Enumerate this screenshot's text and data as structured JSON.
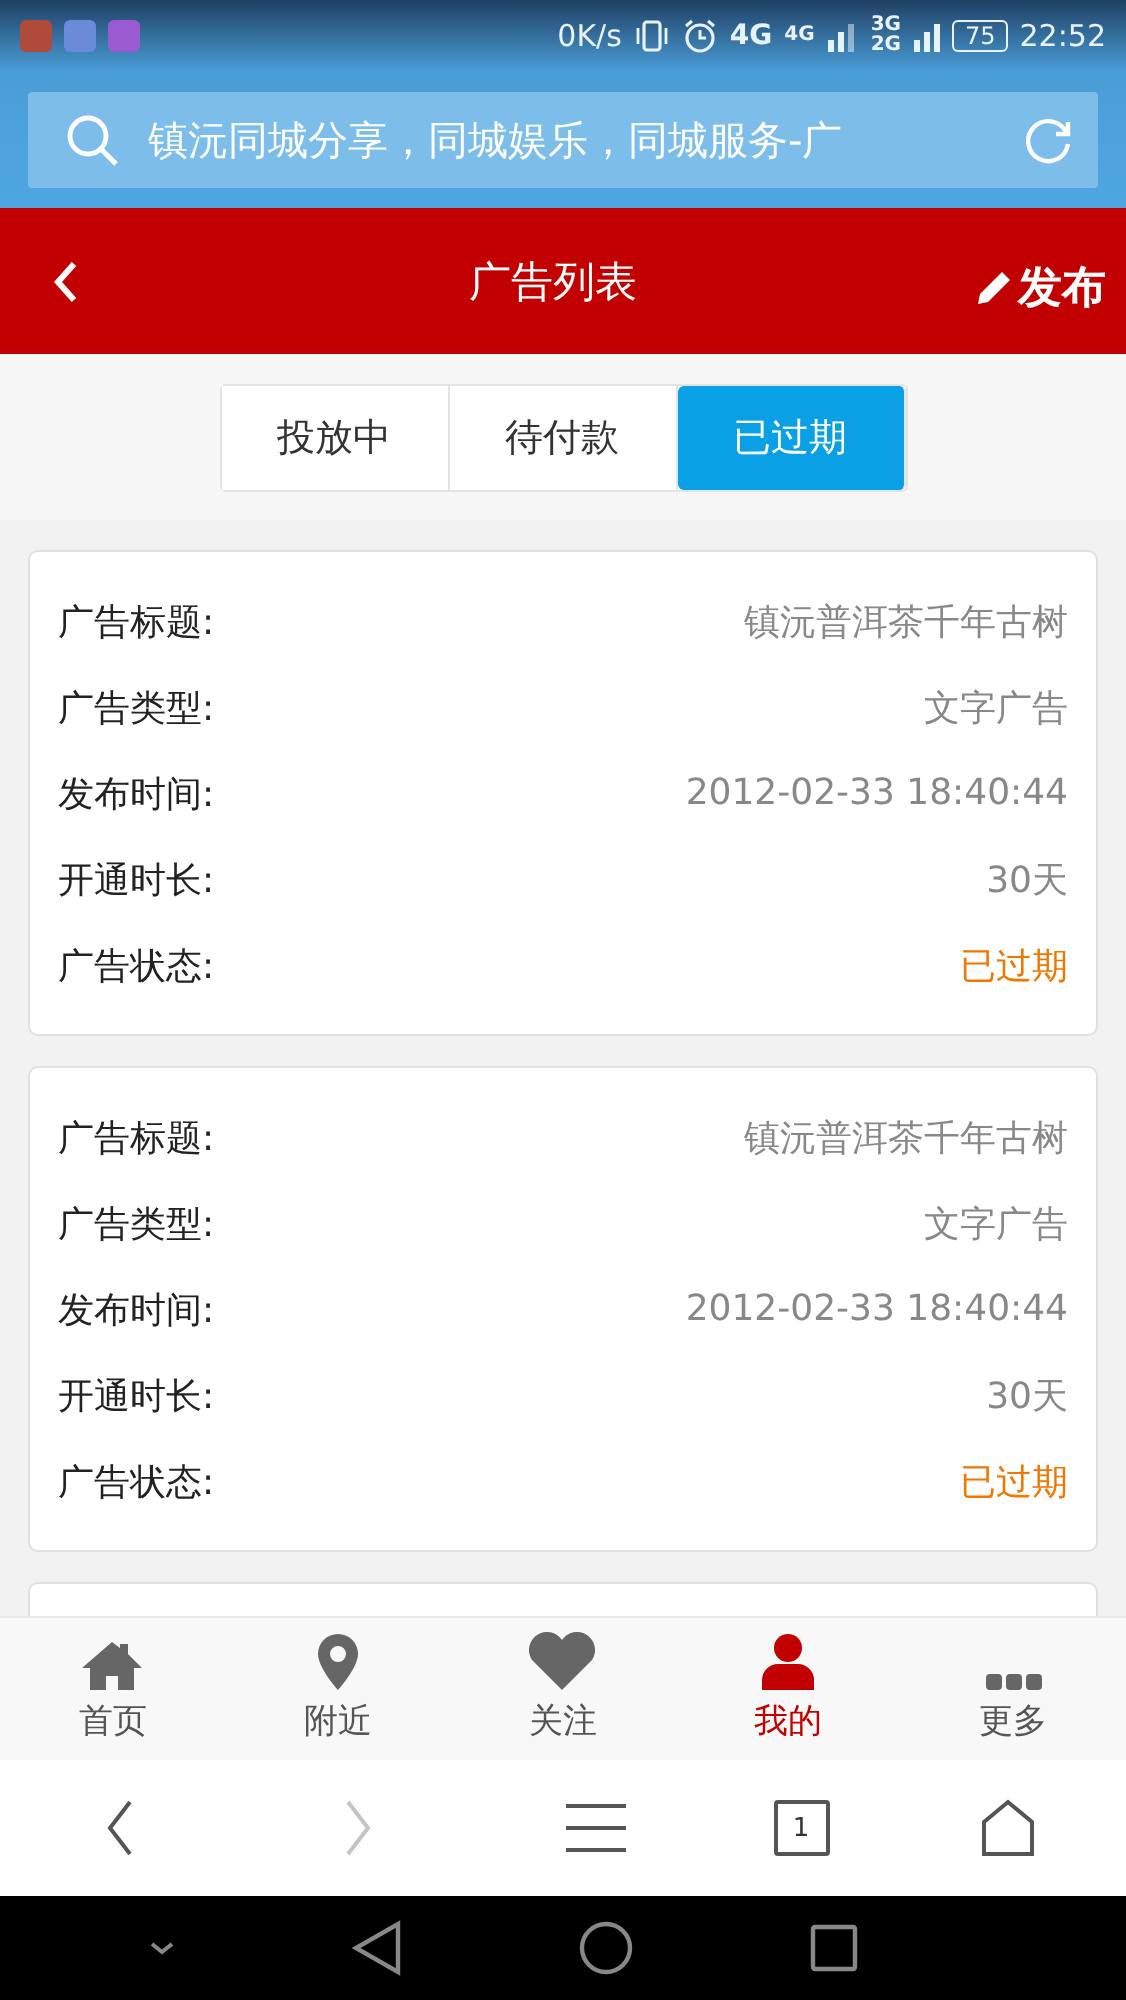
{
  "status_bar": {
    "speed": "0K/s",
    "net_1": "4G",
    "net_2": "4G",
    "net_3": "3G",
    "net_4": "2G",
    "battery": "75",
    "time": "22:52"
  },
  "search": {
    "value": "镇沅同城分享，同城娱乐，同城服务-广"
  },
  "header": {
    "title": "广告列表",
    "action": "发布"
  },
  "tabs": [
    {
      "label": "投放中",
      "selected": false
    },
    {
      "label": "待付款",
      "selected": false
    },
    {
      "label": "已过期",
      "selected": true
    }
  ],
  "ads": [
    {
      "rows": [
        {
          "label": "广告标题:",
          "value": "镇沅普洱茶千年古树",
          "kind": "plain"
        },
        {
          "label": "广告类型:",
          "value": "文字广告",
          "kind": "plain"
        },
        {
          "label": "发布时间:",
          "value": "2012-02-33 18:40:44",
          "kind": "plain"
        },
        {
          "label": "开通时长:",
          "value": "30天",
          "kind": "plain"
        },
        {
          "label": "广告状态:",
          "value": "已过期",
          "kind": "status"
        }
      ]
    },
    {
      "rows": [
        {
          "label": "广告标题:",
          "value": "镇沅普洱茶千年古树",
          "kind": "plain"
        },
        {
          "label": "广告类型:",
          "value": "文字广告",
          "kind": "plain"
        },
        {
          "label": "发布时间:",
          "value": "2012-02-33 18:40:44",
          "kind": "plain"
        },
        {
          "label": "开通时长:",
          "value": "30天",
          "kind": "plain"
        },
        {
          "label": "广告状态:",
          "value": "已过期",
          "kind": "status"
        }
      ]
    }
  ],
  "bottom_nav": [
    {
      "label": "首页",
      "selected": false
    },
    {
      "label": "附近",
      "selected": false
    },
    {
      "label": "关注",
      "selected": false
    },
    {
      "label": "我的",
      "selected": true
    },
    {
      "label": "更多",
      "selected": false
    }
  ],
  "browser_bar": {
    "forward_disabled": true,
    "tab_count": "1"
  }
}
